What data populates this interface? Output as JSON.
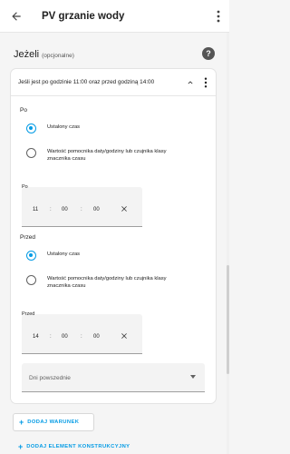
{
  "topbar": {
    "title": "PV grzanie wody",
    "back_icon": "arrow-left-icon",
    "menu_icon": "kebab-icon"
  },
  "section": {
    "title": "Jeżeli",
    "subtitle": "(opcjonalne)",
    "help_label": "?"
  },
  "card": {
    "title": "Jeśli jest po godzinie 11:00 oraz przed godziną 14:00",
    "after": {
      "heading": "Po",
      "options": [
        {
          "label": "Ustalony czas",
          "checked": true
        },
        {
          "label": "Wartość pomocnika daty/godziny lub czujnika klasy znacznika czasu",
          "checked": false
        }
      ],
      "field_label": "Po",
      "hh": "11",
      "mm": "00",
      "ss": "00",
      "sep": ":"
    },
    "before": {
      "heading": "Przed",
      "options": [
        {
          "label": "Ustalony czas",
          "checked": true
        },
        {
          "label": "Wartość pomocnika daty/godziny lub czujnika klasy znacznika czasu",
          "checked": false
        }
      ],
      "field_label": "Przed",
      "hh": "14",
      "mm": "00",
      "ss": "00",
      "sep": ":"
    },
    "weekday_placeholder": "Dni powszednie"
  },
  "buttons": {
    "add_condition": "DODAJ WARUNEK",
    "add_building_block": "DODAJ ELEMENT KONSTRUKCYJNY",
    "plus": "+"
  },
  "colors": {
    "accent": "#039be5"
  }
}
